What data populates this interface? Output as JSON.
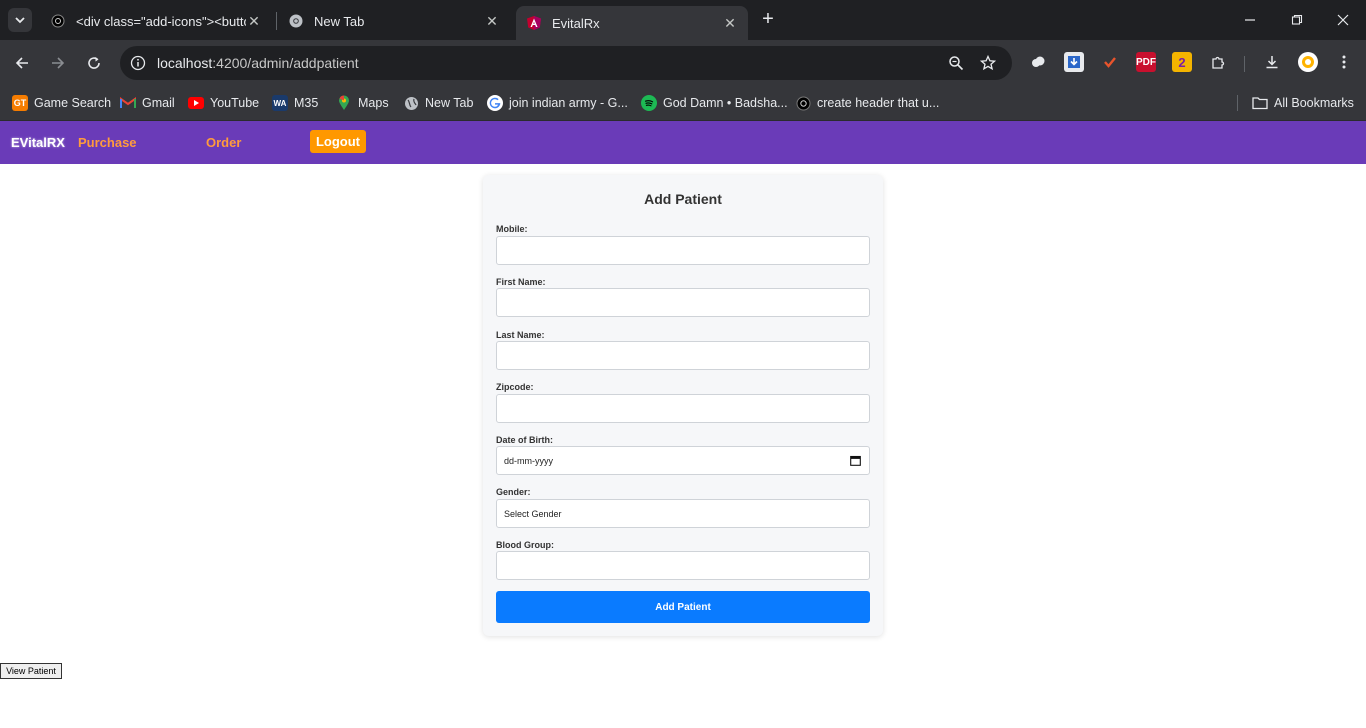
{
  "browser": {
    "tabs": [
      {
        "title": "<div class=\"add-icons\"><button",
        "active": false
      },
      {
        "title": "New Tab",
        "active": false
      },
      {
        "title": "EvitalRx",
        "active": true
      }
    ],
    "address": {
      "host": "localhost",
      "path": ":4200/admin/addpatient"
    },
    "bookmarks": [
      {
        "label": "Game Search",
        "icon": "game-search-icon"
      },
      {
        "label": "Gmail",
        "icon": "gmail-icon"
      },
      {
        "label": "YouTube",
        "icon": "youtube-icon"
      },
      {
        "label": "M35",
        "icon": "wa-icon"
      },
      {
        "label": "Maps",
        "icon": "maps-icon"
      },
      {
        "label": "New Tab",
        "icon": "globe-icon"
      },
      {
        "label": "join indian army - G...",
        "icon": "google-icon"
      },
      {
        "label": "God Damn • Badsha...",
        "icon": "spotify-icon"
      },
      {
        "label": "create header that u...",
        "icon": "openai-icon"
      }
    ],
    "all_bookmarks": "All Bookmarks",
    "ext_badges": {
      "pdf": "PDF",
      "num": "2"
    }
  },
  "header": {
    "brand": "EVitalRX",
    "purchase": "Purchase",
    "order": "Order",
    "logout": "Logout"
  },
  "form": {
    "title": "Add Patient",
    "fields": {
      "mobile": "Mobile:",
      "first_name": "First Name:",
      "last_name": "Last Name:",
      "zipcode": "Zipcode:",
      "dob": "Date of Birth:",
      "dob_placeholder": "dd-mm-yyyy",
      "gender": "Gender:",
      "gender_value": "Select Gender",
      "blood_group": "Blood Group:"
    },
    "submit": "Add Patient"
  },
  "view_patient": "View Patient",
  "colors": {
    "header_bg": "#6a3bb8",
    "nav_link": "#ff9b3d",
    "logout_bg": "#ff9800",
    "submit_bg": "#0a7bff"
  }
}
